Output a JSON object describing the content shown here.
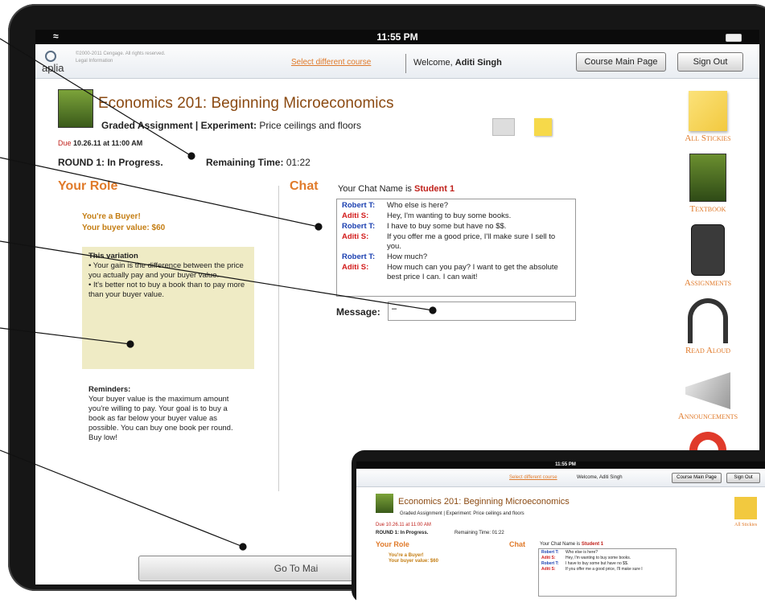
{
  "statusbar": {
    "time": "11:55 PM"
  },
  "topnav": {
    "logo": "aplia",
    "copyright": "©2000-2011 Cengage. All rights reserved.",
    "legal": "Legal   Information",
    "select_course": "Select different course",
    "welcome_prefix": "Welcome,",
    "user_name": "Aditi Singh",
    "course_main_label": "Course Main Page",
    "sign_out_label": "Sign Out"
  },
  "sidebar": {
    "items": [
      {
        "label": "All Stickies",
        "icon": "sticky-note-icon"
      },
      {
        "label": "Textbook",
        "icon": "textbook-icon"
      },
      {
        "label": "Assignments",
        "icon": "assignments-icon"
      },
      {
        "label": "Read Aloud",
        "icon": "headphones-icon"
      },
      {
        "label": "Announcements",
        "icon": "megaphone-icon"
      },
      {
        "label": "",
        "icon": "lifering-icon"
      }
    ]
  },
  "course": {
    "title": "Economics 201: Beginning Microeconomics",
    "assignment_type": "Graded Assignment | Experiment:",
    "assignment_name": "Price ceilings and floors",
    "due_label": "Due",
    "due_value": "10.26.11 at 11:00 AM"
  },
  "round": {
    "status": "ROUND 1: In Progress.",
    "remaining_label": "Remaining Time:",
    "remaining_value": "01:22"
  },
  "role": {
    "heading": "Your Role",
    "line1": "You're a Buyer!",
    "line2": "Your buyer value: $60",
    "variation_title": "This variation",
    "variation_text1": "• Your gain is the difference between the price you actually pay and your buyer value.",
    "variation_text2": "• It's better not to buy a book than to pay more than your buyer value.",
    "reminders_title": "Reminders:",
    "reminders_text": "Your buyer value is the maximum amount you're willing to pay. Your goal is to buy a book as far below your buyer value as possible. You can buy one book per round. Buy low!"
  },
  "chat": {
    "heading": "Chat",
    "name_prefix": "Your Chat Name is",
    "name_value": "Student 1",
    "messages": [
      {
        "who": "Robert T:",
        "text": "Who else is here?",
        "color": "#1a3fb0"
      },
      {
        "who": "Aditi S:",
        "text": "Hey, I'm wanting to buy some books.",
        "color": "#d21b1b"
      },
      {
        "who": "Robert T:",
        "text": "I have to buy some but have no $$.",
        "color": "#1a3fb0"
      },
      {
        "who": "Aditi S:",
        "text": "If you offer me a good price, I'll make sure I sell to you.",
        "color": "#d21b1b"
      },
      {
        "who": "Robert T:",
        "text": "How much?",
        "color": "#1a3fb0"
      },
      {
        "who": "Aditi S:",
        "text": "How much can you pay? I want to get the absolute best price I can. I can wait!",
        "color": "#d21b1b"
      }
    ],
    "message_label": "Message:",
    "message_value": "–"
  },
  "footer": {
    "goto_label": "Go To Mai"
  },
  "inset": {
    "time": "11:55 PM",
    "select_course": "Select different course",
    "welcome": "Welcome, Aditi Singh",
    "course_main_label": "Course Main Page",
    "sign_out_label": "Sign Out",
    "title": "Economics 201: Beginning Microeconomics",
    "assignment": "Graded Assignment | Experiment: Price ceilings and floors",
    "due": "Due 10.26.11 at 11:00 AM",
    "round": "ROUND 1: In Progress.",
    "remaining": "Remaining Time: 01:22",
    "role_heading": "Your Role",
    "buyer1": "You're a Buyer!",
    "buyer2": "Your buyer value: $60",
    "chat_heading": "Chat",
    "chat_name_prefix": "Your Chat Name is",
    "chat_name_value": "Student 1",
    "side_label": "All Stickies",
    "messages": [
      {
        "who": "Robert T:",
        "text": "Who else is here?"
      },
      {
        "who": "Aditi S:",
        "text": "Hey, I'm wanting to buy some books."
      },
      {
        "who": "Robert T:",
        "text": "I have to buy some but have no $$."
      },
      {
        "who": "Aditi S:",
        "text": "If you offer me a good price, I'll make sure I"
      }
    ]
  },
  "colors": {
    "accent": "#e07a2a",
    "title": "#8b4a12",
    "red": "#d21b1b",
    "blue": "#1a3fb0",
    "variation_bg": "#efebc5"
  }
}
